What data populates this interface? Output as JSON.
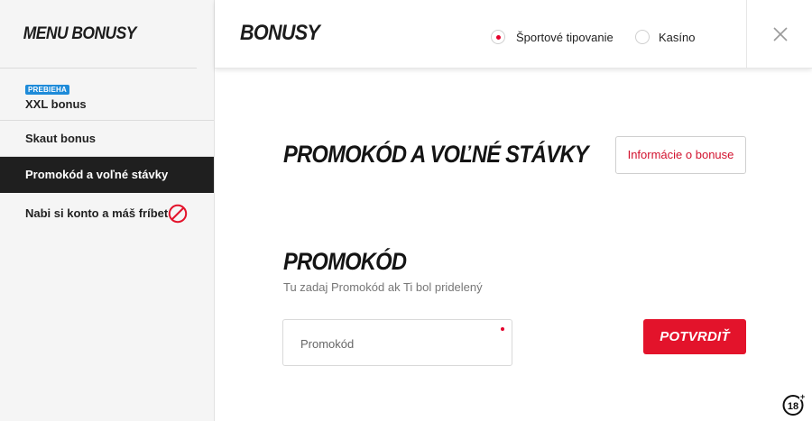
{
  "sidebar": {
    "title": "MENU BONUSY",
    "items": [
      {
        "badge": "PREBIEHA",
        "label": "XXL bonus"
      },
      {
        "label": "Skaut bonus"
      },
      {
        "label": "Promokód a voľné stávky",
        "active": true
      },
      {
        "label": "Nabi si konto a máš fríbet",
        "icon": "ban-icon"
      }
    ]
  },
  "header": {
    "title": "BONUSY",
    "options": [
      {
        "label": "Športové tipovanie",
        "selected": true
      },
      {
        "label": "Kasíno",
        "selected": false
      }
    ],
    "close_icon": "close-icon"
  },
  "main": {
    "section_title": "PROMOKÓD A VOĽNÉ STÁVKY",
    "info_button": "Informácie o bonuse",
    "promo_title": "PROMOKÓD",
    "promo_subtitle": "Tu zadaj Promokód ak Ti bol pridelený",
    "promo_placeholder": "Promokód",
    "confirm_button": "POTVRDIŤ"
  },
  "footer": {
    "age_badge": "18+"
  },
  "colors": {
    "accent": "#e3132b",
    "badge": "#1e8bd9",
    "active_bg": "#1f1f1f"
  }
}
